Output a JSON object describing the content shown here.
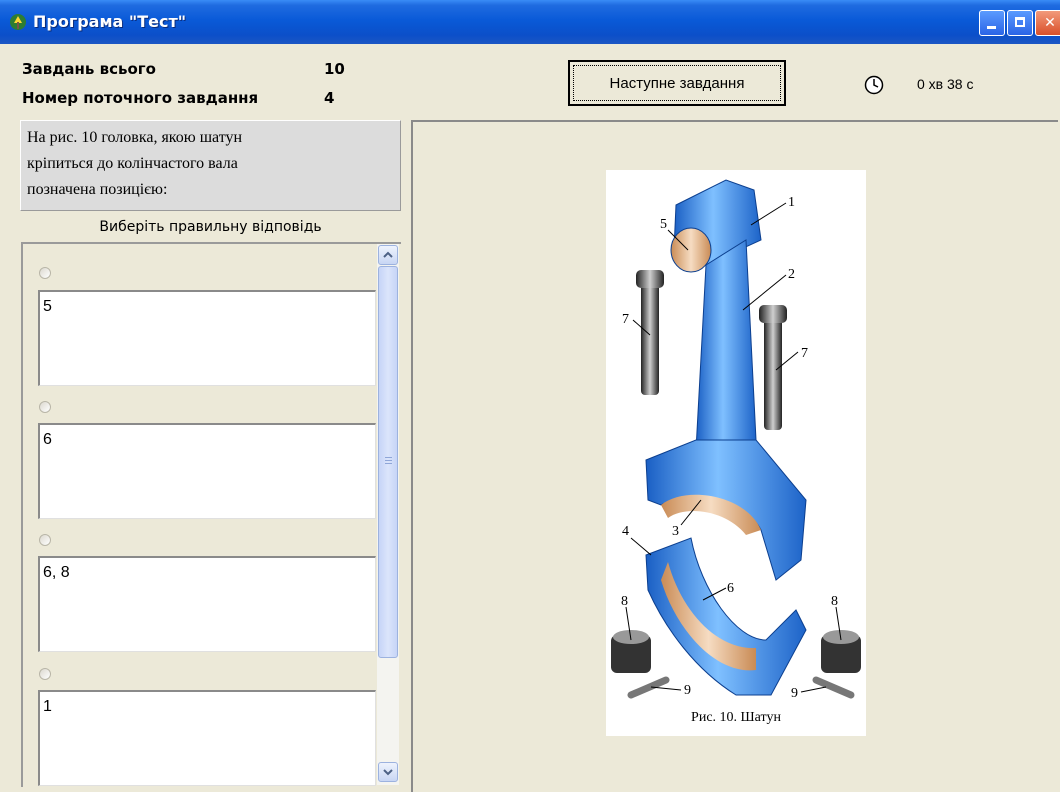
{
  "window": {
    "title": "Програма \"Тест\""
  },
  "header": {
    "total_label": "Завдань всього",
    "total_value": "10",
    "current_label": "Номер поточного завдання",
    "current_value": "4",
    "next_button": "Наступне завдання",
    "timer": "0 хв 38 с"
  },
  "question": {
    "text": "На рис. 10 головка, якою шатун\nкріпиться до колінчастого вала\nпозначена позицією:"
  },
  "choose_label": "Виберіть правильну відповідь",
  "answers": [
    {
      "text": "5"
    },
    {
      "text": "6"
    },
    {
      "text": "6, 8"
    },
    {
      "text": "1"
    }
  ],
  "figure": {
    "caption": "Рис. 10.    Шатун",
    "labels": [
      "1",
      "2",
      "3",
      "4",
      "5",
      "6",
      "7",
      "7",
      "8",
      "8",
      "9",
      "9"
    ]
  },
  "colors": {
    "titlebar": "#0a5ad8",
    "part_blue": "#2f86e8",
    "bearing": "#d9a070",
    "window_bg": "#ece9d8"
  },
  "icons": {
    "app": "app-icon",
    "clock": "clock-icon",
    "minimize": "minimize-icon",
    "maximize": "maximize-icon",
    "close": "close-icon"
  }
}
